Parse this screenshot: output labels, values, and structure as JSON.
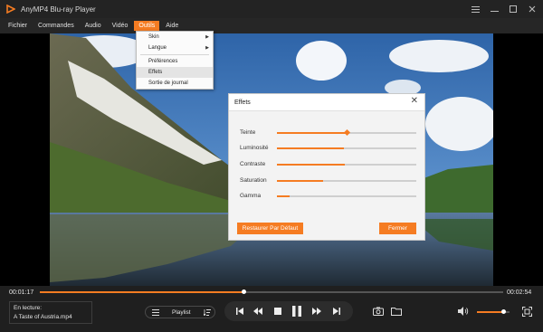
{
  "window": {
    "title": "AnyMP4 Blu-ray Player",
    "controls": [
      "menu-icon",
      "minimize-icon",
      "maximize-icon",
      "close-icon"
    ]
  },
  "menubar": {
    "items": [
      "Fichier",
      "Commandes",
      "Audio",
      "Vidéo",
      "Outils",
      "Aide"
    ],
    "active": "Outils"
  },
  "tools_menu": {
    "items": [
      {
        "label": "Skin",
        "submenu": true
      },
      {
        "label": "Langue",
        "submenu": true
      },
      {
        "label": "Préférences",
        "submenu": false
      },
      {
        "label": "Effets",
        "submenu": false,
        "highlighted": true
      },
      {
        "label": "Sortie de journal",
        "submenu": false
      }
    ]
  },
  "effects_dialog": {
    "title": "Effets",
    "sliders": [
      {
        "label": "Teinte",
        "value": 0.5
      },
      {
        "label": "Luminosité",
        "value": 0.48
      },
      {
        "label": "Contraste",
        "value": 0.49
      },
      {
        "label": "Saturation",
        "value": 0.33
      },
      {
        "label": "Gamma",
        "value": 0.09
      }
    ],
    "reset_label": "Restaurer Par Défaut",
    "close_label": "Fermer"
  },
  "player": {
    "elapsed": "00:01:17",
    "total": "00:02:54",
    "progress": 0.44,
    "now_playing_label": "En lecture:",
    "now_playing_file": "A Taste of Austria.mp4",
    "playlist_label": "Playlist",
    "volume": 0.8
  },
  "colors": {
    "accent": "#f57c22",
    "background": "#1c1c1c"
  }
}
